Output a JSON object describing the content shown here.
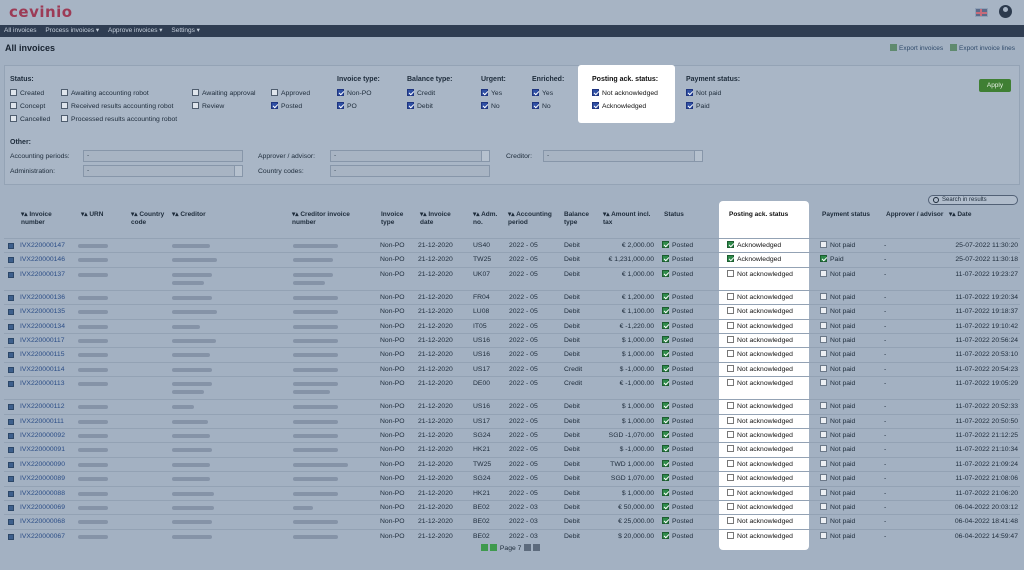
{
  "app": {
    "logo": "cevinio"
  },
  "nav": [
    "All invoices",
    "Process invoices ▾",
    "Approve invoices ▾",
    "Settings ▾"
  ],
  "page": {
    "title": "All invoices",
    "export_invoices": "Export invoices",
    "export_lines": "Export invoice lines"
  },
  "filters": {
    "status_label": "Status:",
    "status_options": [
      {
        "label": "Created",
        "checked": false
      },
      {
        "label": "Concept",
        "checked": false
      },
      {
        "label": "Cancelled",
        "checked": false
      },
      {
        "label": "Awaiting accounting robot",
        "checked": false
      },
      {
        "label": "Received results accounting robot",
        "checked": false
      },
      {
        "label": "Processed results accounting robot",
        "checked": false
      },
      {
        "label": "Awaiting approval",
        "checked": false
      },
      {
        "label": "Review",
        "checked": false
      },
      {
        "label": "Approved",
        "checked": false
      },
      {
        "label": "Posted",
        "checked": true
      }
    ],
    "invoice_type_label": "Invoice type:",
    "invoice_type": [
      "Non-PO",
      "PO"
    ],
    "balance_type_label": "Balance type:",
    "balance_type": [
      "Credit",
      "Debit"
    ],
    "urgent_label": "Urgent:",
    "urgent": [
      "Yes",
      "No"
    ],
    "enriched_label": "Enriched:",
    "enriched": [
      "Yes",
      "No"
    ],
    "posting_ack_label": "Posting ack. status:",
    "posting_ack": [
      "Not acknowledged",
      "Acknowledged"
    ],
    "payment_label": "Payment status:",
    "payment": [
      "Not paid",
      "Paid"
    ],
    "apply": "Apply",
    "other_label": "Other:",
    "accounting_periods_label": "Accounting periods:",
    "administration_label": "Administration:",
    "approver_label": "Approver / advisor:",
    "country_codes_label": "Country codes:",
    "creditor_label": "Creditor:",
    "select_placeholder": "-"
  },
  "search": {
    "placeholder": "Search in results"
  },
  "table": {
    "headers": {
      "invoice_number": "Invoice number",
      "urn": "URN",
      "country_code": "Country code",
      "creditor": "Creditor",
      "creditor_invoice_number": "Creditor invoice number",
      "invoice_type": "Invoice type",
      "invoice_date": "Invoice date",
      "adm_no": "Adm. no.",
      "accounting_period": "Accounting period",
      "balance_type": "Balance type",
      "amount": "Amount incl. tax",
      "status": "Status",
      "posting_ack": "Posting ack. status",
      "payment_status": "Payment status",
      "approver": "Approver / advisor",
      "date": "Date"
    },
    "rows": [
      {
        "inv": "IVX220000147",
        "type": "Non-PO",
        "idate": "21-12-2020",
        "adm": "US40",
        "period": "2022 - 05",
        "bal": "Debit",
        "amt": "€ 2,000.00",
        "status": "Posted",
        "ack": "Acknowledged",
        "ack_on": true,
        "pay": "Not paid",
        "pay_on": false,
        "appr": "-",
        "date": "25-07-2022 11:30:20"
      },
      {
        "inv": "IVX220000146",
        "type": "Non-PO",
        "idate": "21-12-2020",
        "adm": "TW25",
        "period": "2022 - 05",
        "bal": "Debit",
        "amt": "€ 1,231,000.00",
        "status": "Posted",
        "ack": "Acknowledged",
        "ack_on": true,
        "pay": "Paid",
        "pay_on": true,
        "appr": "-",
        "date": "25-07-2022 11:30:18"
      },
      {
        "inv": "IVX220000137",
        "type": "Non-PO",
        "idate": "21-12-2020",
        "adm": "UK07",
        "period": "2022 - 05",
        "bal": "Debit",
        "amt": "€ 1,000.00",
        "status": "Posted",
        "ack": "Not acknowledged",
        "ack_on": false,
        "pay": "Not paid",
        "pay_on": false,
        "appr": "-",
        "date": "11-07-2022 19:23:27"
      },
      {
        "inv": "IVX220000136",
        "type": "Non-PO",
        "idate": "21-12-2020",
        "adm": "FR04",
        "period": "2022 - 05",
        "bal": "Debit",
        "amt": "€ 1,200.00",
        "status": "Posted",
        "ack": "Not acknowledged",
        "ack_on": false,
        "pay": "Not paid",
        "pay_on": false,
        "appr": "-",
        "date": "11-07-2022 19:20:34"
      },
      {
        "inv": "IVX220000135",
        "type": "Non-PO",
        "idate": "21-12-2020",
        "adm": "LU08",
        "period": "2022 - 05",
        "bal": "Debit",
        "amt": "€ 1,100.00",
        "status": "Posted",
        "ack": "Not acknowledged",
        "ack_on": false,
        "pay": "Not paid",
        "pay_on": false,
        "appr": "-",
        "date": "11-07-2022 19:18:37"
      },
      {
        "inv": "IVX220000134",
        "type": "Non-PO",
        "idate": "21-12-2020",
        "adm": "IT05",
        "period": "2022 - 05",
        "bal": "Debit",
        "amt": "€ -1,220.00",
        "status": "Posted",
        "ack": "Not acknowledged",
        "ack_on": false,
        "pay": "Not paid",
        "pay_on": false,
        "appr": "-",
        "date": "11-07-2022 19:10:42"
      },
      {
        "inv": "IVX220000117",
        "type": "Non-PO",
        "idate": "21-12-2020",
        "adm": "US16",
        "period": "2022 - 05",
        "bal": "Debit",
        "amt": "$ 1,000.00",
        "status": "Posted",
        "ack": "Not acknowledged",
        "ack_on": false,
        "pay": "Not paid",
        "pay_on": false,
        "appr": "-",
        "date": "11-07-2022 20:56:24"
      },
      {
        "inv": "IVX220000115",
        "type": "Non-PO",
        "idate": "21-12-2020",
        "adm": "US16",
        "period": "2022 - 05",
        "bal": "Debit",
        "amt": "$ 1,000.00",
        "status": "Posted",
        "ack": "Not acknowledged",
        "ack_on": false,
        "pay": "Not paid",
        "pay_on": false,
        "appr": "-",
        "date": "11-07-2022 20:53:10"
      },
      {
        "inv": "IVX220000114",
        "type": "Non-PO",
        "idate": "21-12-2020",
        "adm": "US17",
        "period": "2022 - 05",
        "bal": "Credit",
        "amt": "$ -1,000.00",
        "status": "Posted",
        "ack": "Not acknowledged",
        "ack_on": false,
        "pay": "Not paid",
        "pay_on": false,
        "appr": "-",
        "date": "11-07-2022 20:54:23"
      },
      {
        "inv": "IVX220000113",
        "type": "Non-PO",
        "idate": "21-12-2020",
        "adm": "DE00",
        "period": "2022 - 05",
        "bal": "Credit",
        "amt": "€ -1,000.00",
        "status": "Posted",
        "ack": "Not acknowledged",
        "ack_on": false,
        "pay": "Not paid",
        "pay_on": false,
        "appr": "-",
        "date": "11-07-2022 19:05:29"
      },
      {
        "inv": "IVX220000112",
        "type": "Non-PO",
        "idate": "21-12-2020",
        "adm": "US16",
        "period": "2022 - 05",
        "bal": "Debit",
        "amt": "$ 1,000.00",
        "status": "Posted",
        "ack": "Not acknowledged",
        "ack_on": false,
        "pay": "Not paid",
        "pay_on": false,
        "appr": "-",
        "date": "11-07-2022 20:52:33"
      },
      {
        "inv": "IVX220000111",
        "type": "Non-PO",
        "idate": "21-12-2020",
        "adm": "US17",
        "period": "2022 - 05",
        "bal": "Debit",
        "amt": "$ 1,000.00",
        "status": "Posted",
        "ack": "Not acknowledged",
        "ack_on": false,
        "pay": "Not paid",
        "pay_on": false,
        "appr": "-",
        "date": "11-07-2022 20:50:50"
      },
      {
        "inv": "IVX220000092",
        "type": "Non-PO",
        "idate": "21-12-2020",
        "adm": "SG24",
        "period": "2022 - 05",
        "bal": "Debit",
        "amt": "SGD -1,070.00",
        "status": "Posted",
        "ack": "Not acknowledged",
        "ack_on": false,
        "pay": "Not paid",
        "pay_on": false,
        "appr": "-",
        "date": "11-07-2022 21:12:25"
      },
      {
        "inv": "IVX220000091",
        "type": "Non-PO",
        "idate": "21-12-2020",
        "adm": "HK21",
        "period": "2022 - 05",
        "bal": "Debit",
        "amt": "$ -1,000.00",
        "status": "Posted",
        "ack": "Not acknowledged",
        "ack_on": false,
        "pay": "Not paid",
        "pay_on": false,
        "appr": "-",
        "date": "11-07-2022 21:10:34"
      },
      {
        "inv": "IVX220000090",
        "type": "Non-PO",
        "idate": "21-12-2020",
        "adm": "TW25",
        "period": "2022 - 05",
        "bal": "Debit",
        "amt": "TWD 1,000.00",
        "status": "Posted",
        "ack": "Not acknowledged",
        "ack_on": false,
        "pay": "Not paid",
        "pay_on": false,
        "appr": "-",
        "date": "11-07-2022 21:09:24"
      },
      {
        "inv": "IVX220000089",
        "type": "Non-PO",
        "idate": "21-12-2020",
        "adm": "SG24",
        "period": "2022 - 05",
        "bal": "Debit",
        "amt": "SGD 1,070.00",
        "status": "Posted",
        "ack": "Not acknowledged",
        "ack_on": false,
        "pay": "Not paid",
        "pay_on": false,
        "appr": "-",
        "date": "11-07-2022 21:08:06"
      },
      {
        "inv": "IVX220000088",
        "type": "Non-PO",
        "idate": "21-12-2020",
        "adm": "HK21",
        "period": "2022 - 05",
        "bal": "Debit",
        "amt": "$ 1,000.00",
        "status": "Posted",
        "ack": "Not acknowledged",
        "ack_on": false,
        "pay": "Not paid",
        "pay_on": false,
        "appr": "-",
        "date": "11-07-2022 21:06:20"
      },
      {
        "inv": "IVX220000069",
        "type": "Non-PO",
        "idate": "21-12-2020",
        "adm": "BE02",
        "period": "2022 - 03",
        "bal": "Debit",
        "amt": "€ 50,000.00",
        "status": "Posted",
        "ack": "Not acknowledged",
        "ack_on": false,
        "pay": "Not paid",
        "pay_on": false,
        "appr": "-",
        "date": "06-04-2022 20:03:12"
      },
      {
        "inv": "IVX220000068",
        "type": "Non-PO",
        "idate": "21-12-2020",
        "adm": "BE02",
        "period": "2022 - 03",
        "bal": "Debit",
        "amt": "€ 25,000.00",
        "status": "Posted",
        "ack": "Not acknowledged",
        "ack_on": false,
        "pay": "Not paid",
        "pay_on": false,
        "appr": "-",
        "date": "06-04-2022 18:41:48"
      },
      {
        "inv": "IVX220000067",
        "type": "Non-PO",
        "idate": "21-12-2020",
        "adm": "BE02",
        "period": "2022 - 03",
        "bal": "Debit",
        "amt": "$ 20,000.00",
        "status": "Posted",
        "ack": "Not acknowledged",
        "ack_on": false,
        "pay": "Not paid",
        "pay_on": false,
        "appr": "-",
        "date": "06-04-2022 14:59:47"
      }
    ]
  },
  "pager": {
    "label": "Page 7"
  }
}
